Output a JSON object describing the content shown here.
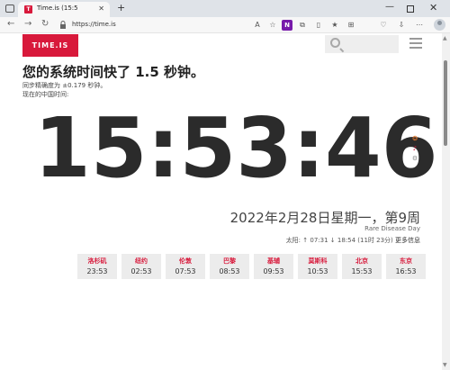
{
  "browser": {
    "tab_title": "Time.is (15:5",
    "tab_favicon": "T",
    "url": "https://time.is",
    "onenote_label": "N"
  },
  "site": {
    "logo": "TIME.IS",
    "search_placeholder": ""
  },
  "main": {
    "headline": "您的系统时间快了 1.5 秒钟。",
    "accuracy": "同步精确度为 ±0.179 秒钟。",
    "current_label": "现在的中国时间:",
    "clock": "15:53:46",
    "date": "2022年2月28日星期一，第9周",
    "holiday": "Rare Disease Day",
    "sun_label": "太阳:",
    "sun_times": "↑ 07:31 ↓ 18:54 (11时 23分)",
    "more_info": "更多信息"
  },
  "cities": [
    {
      "name": "洛杉矶",
      "time": "23:53"
    },
    {
      "name": "纽约",
      "time": "02:53"
    },
    {
      "name": "伦敦",
      "time": "07:53"
    },
    {
      "name": "巴黎",
      "time": "08:53"
    },
    {
      "name": "基辅",
      "time": "09:53"
    },
    {
      "name": "莫斯科",
      "time": "10:53"
    },
    {
      "name": "北京",
      "time": "15:53"
    },
    {
      "name": "东京",
      "time": "16:53"
    }
  ],
  "icons": [
    "window-icon",
    "back-icon",
    "forward-icon",
    "refresh-icon",
    "home-icon",
    "lock-icon",
    "read-aloud-icon",
    "favorite-star-icon",
    "onenote-icon",
    "extensions-icon",
    "split-screen-icon",
    "favorites-icon",
    "collections-icon",
    "browser-essentials-icon",
    "profile-icon",
    "search-icon",
    "menu-icon",
    "share-icon",
    "notification-icon",
    "settings-icon"
  ],
  "colors": {
    "brand": "#d8193b",
    "clock": "#2b2b2b",
    "city_bg": "#ececec"
  }
}
